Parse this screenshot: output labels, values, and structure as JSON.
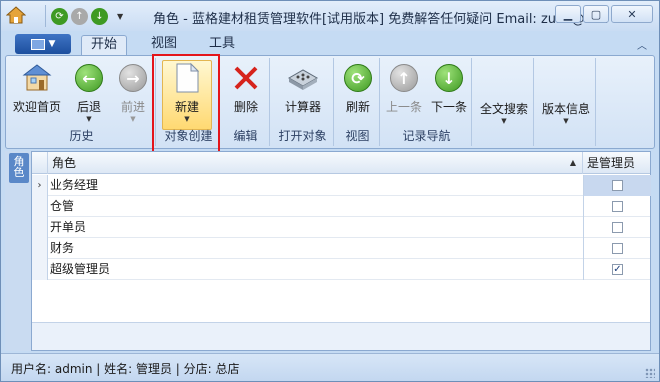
{
  "window": {
    "title": "角色 - 蓝格建材租赁管理软件[试用版本] 免费解答任何疑问 Email: zulin@la...",
    "controls": [
      "minimize",
      "maximize",
      "close"
    ]
  },
  "ribbon_tabs": [
    {
      "label": "开始",
      "active": true
    },
    {
      "label": "视图",
      "active": false
    },
    {
      "label": "工具",
      "active": false
    }
  ],
  "ribbon_groups": [
    {
      "label": "历史",
      "buttons": [
        {
          "label": "欢迎首页",
          "icon": "home-icon",
          "enabled": true
        },
        {
          "label": "后退",
          "icon": "back-arrow-icon",
          "enabled": true
        },
        {
          "label": "前进",
          "icon": "forward-arrow-icon",
          "enabled": false
        }
      ]
    },
    {
      "label": "对象创建",
      "buttons": [
        {
          "label": "新建",
          "icon": "new-document-icon",
          "enabled": true
        }
      ]
    },
    {
      "label": "编辑",
      "buttons": [
        {
          "label": "删除",
          "icon": "delete-x-icon",
          "enabled": true
        }
      ]
    },
    {
      "label": "打开对象",
      "buttons": [
        {
          "label": "计算器",
          "icon": "calculator-icon",
          "enabled": true
        }
      ]
    },
    {
      "label": "视图",
      "buttons": [
        {
          "label": "刷新",
          "icon": "refresh-icon",
          "enabled": true
        }
      ]
    },
    {
      "label": "记录导航",
      "buttons": [
        {
          "label": "上一条",
          "icon": "up-arrow-icon",
          "enabled": false
        },
        {
          "label": "下一条",
          "icon": "down-arrow-icon",
          "enabled": true
        }
      ]
    },
    {
      "label": "",
      "buttons": [
        {
          "label": "全文搜索",
          "icon": "",
          "enabled": true
        }
      ]
    },
    {
      "label": "",
      "buttons": [
        {
          "label": "版本信息",
          "icon": "",
          "enabled": true
        }
      ]
    }
  ],
  "side_tab": {
    "label": "角色"
  },
  "grid": {
    "columns": [
      "角色",
      "是管理员"
    ],
    "rows": [
      {
        "role": "业务经理",
        "is_admin": false,
        "selected": true
      },
      {
        "role": "仓管",
        "is_admin": false,
        "selected": false
      },
      {
        "role": "开单员",
        "is_admin": false,
        "selected": false
      },
      {
        "role": "财务",
        "is_admin": false,
        "selected": false
      },
      {
        "role": "超级管理员",
        "is_admin": true,
        "selected": false
      }
    ]
  },
  "status_bar": {
    "text": "用户名: admin  | 姓名: 管理员  | 分店: 总店"
  },
  "colors": {
    "highlight_box": "#e4151b",
    "ribbon_bg": "#d2e2f5",
    "green_button": "#3f9a23"
  }
}
